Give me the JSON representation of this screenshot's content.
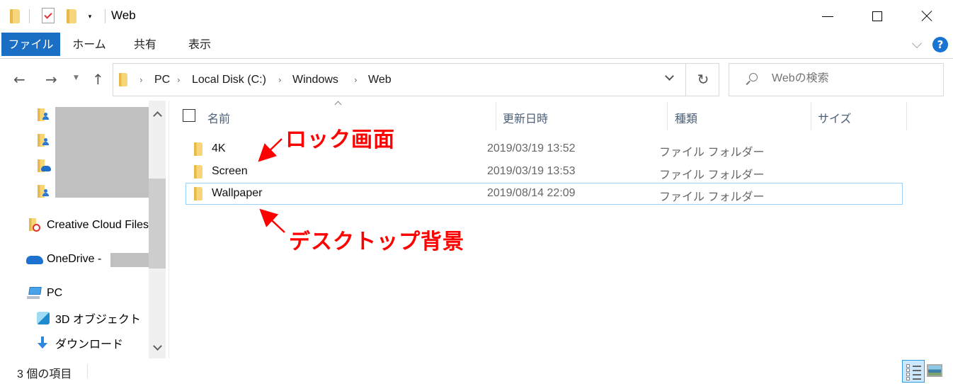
{
  "window": {
    "title": "Web",
    "controls": {
      "minimize": "minimize",
      "maximize": "maximize",
      "close": "close"
    }
  },
  "quick_access": {
    "icons": [
      "folder-icon",
      "properties-icon",
      "new-folder-icon",
      "customize-dropdown-icon"
    ],
    "dropdown_glyph": "▾"
  },
  "ribbon": {
    "tabs": [
      {
        "label": "ファイル",
        "active": true
      },
      {
        "label": "ホーム"
      },
      {
        "label": "共有"
      },
      {
        "label": "表示"
      }
    ],
    "help_label": "?"
  },
  "navbar": {
    "back_glyph": "←",
    "forward_glyph": "→",
    "recent_glyph": "⌄",
    "up_glyph": "↑",
    "refresh_glyph": "↻",
    "breadcrumbs": [
      "PC",
      "Local Disk (C:)",
      "Windows",
      "Web"
    ],
    "breadcrumb_separator": "›",
    "search": {
      "placeholder": "Webの検索",
      "value": ""
    }
  },
  "navigation_pane": {
    "items": [
      {
        "label": "",
        "icon": "user-folder-icon",
        "redacted": true
      },
      {
        "label": "",
        "icon": "user-folder-icon",
        "redacted": true
      },
      {
        "label": "",
        "icon": "onedrive-folder-icon",
        "redacted": true
      },
      {
        "label": "",
        "icon": "user-folder-icon",
        "redacted": true
      },
      {
        "label": "Creative Cloud Files",
        "icon": "creative-cloud-icon"
      },
      {
        "label": "OneDrive - ",
        "icon": "onedrive-icon",
        "redacted_suffix": true
      },
      {
        "label": "PC",
        "icon": "pc-icon"
      },
      {
        "label": "3D オブジェクト",
        "icon": "3d-objects-icon"
      },
      {
        "label": "ダウンロード",
        "icon": "downloads-icon"
      }
    ]
  },
  "file_list": {
    "columns": [
      {
        "key": "name",
        "label": "名前",
        "sorted": "ascending"
      },
      {
        "key": "date",
        "label": "更新日時"
      },
      {
        "key": "type",
        "label": "種類"
      },
      {
        "key": "size",
        "label": "サイズ"
      }
    ],
    "rows": [
      {
        "name": "4K",
        "date": "2019/03/19 13:52",
        "type": "ファイル フォルダー",
        "size": ""
      },
      {
        "name": "Screen",
        "date": "2019/03/19 13:53",
        "type": "ファイル フォルダー",
        "size": ""
      },
      {
        "name": "Wallpaper",
        "date": "2019/08/14 22:09",
        "type": "ファイル フォルダー",
        "size": "",
        "focused": true
      }
    ]
  },
  "annotations": [
    {
      "text": "ロック画面",
      "points_to": "Screen",
      "color": "#ff0000"
    },
    {
      "text": "デスクトップ背景",
      "points_to": "Wallpaper",
      "color": "#ff0000"
    }
  ],
  "status_bar": {
    "item_count": "3 個の項目",
    "views": [
      {
        "name": "details-view",
        "active": true
      },
      {
        "name": "large-icons-view",
        "active": false
      }
    ]
  },
  "colors": {
    "accent": "#1a6fc4",
    "help": "#1874d2",
    "focus_border": "#99d1ff",
    "annotation": "#ff0000"
  }
}
